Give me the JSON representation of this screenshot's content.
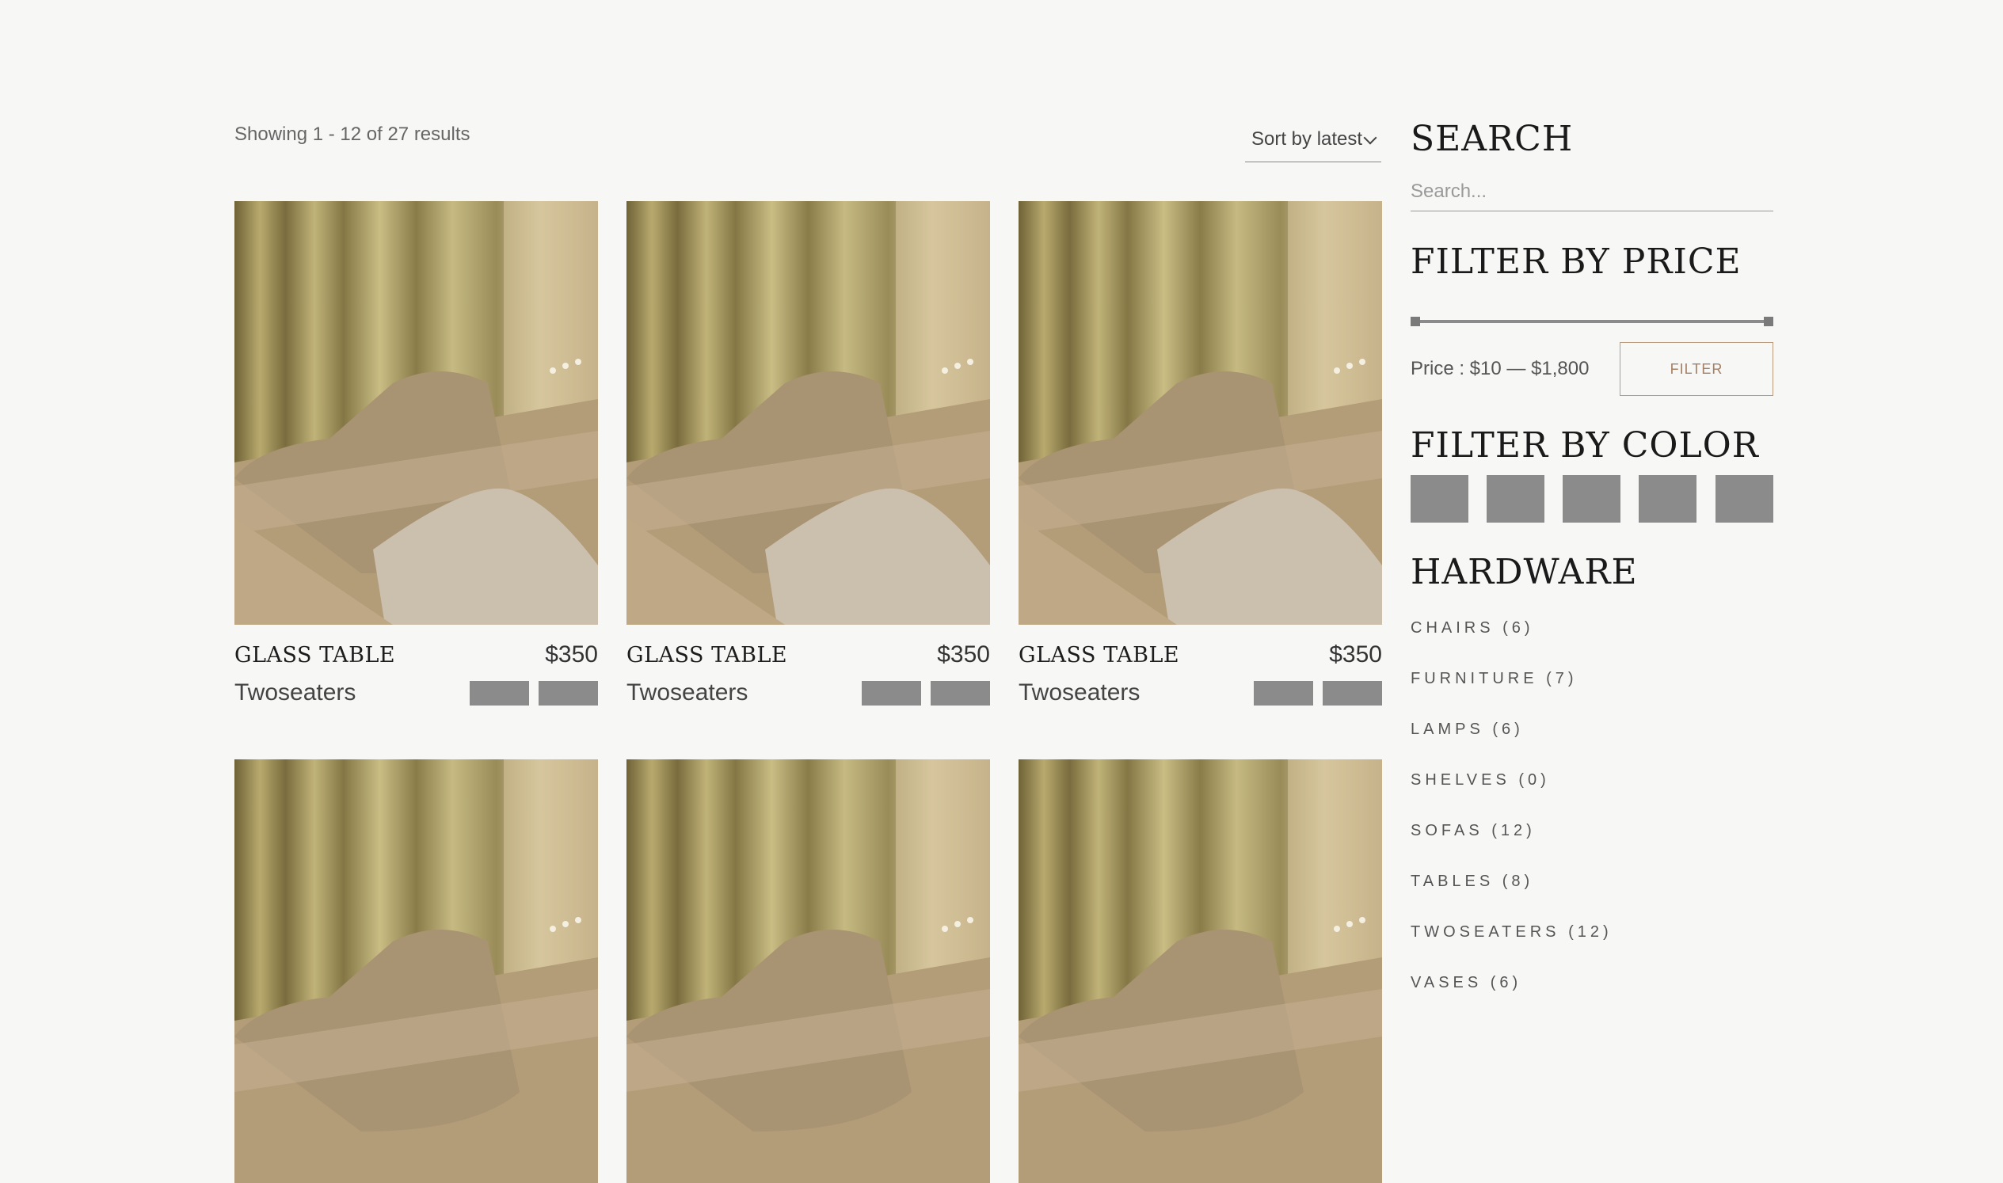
{
  "toolbar": {
    "results_text": "Showing 1 - 12 of 27 results",
    "sort_label": "Sort by latest"
  },
  "products": [
    {
      "title": "GLASS TABLE",
      "price": "$350",
      "category": "Twoseaters"
    },
    {
      "title": "GLASS TABLE",
      "price": "$350",
      "category": "Twoseaters"
    },
    {
      "title": "GLASS TABLE",
      "price": "$350",
      "category": "Twoseaters"
    },
    {
      "title": "",
      "price": "",
      "category": ""
    },
    {
      "title": "",
      "price": "",
      "category": ""
    },
    {
      "title": "",
      "price": "",
      "category": ""
    }
  ],
  "sidebar": {
    "search": {
      "heading": "SEARCH",
      "placeholder": "Search..."
    },
    "price": {
      "heading": "FILTER BY PRICE",
      "range_text": "Price : $10 — $1,800",
      "button_label": "FILTER",
      "min_fraction": 0,
      "max_fraction": 1
    },
    "color": {
      "heading": "FILTER BY COLOR",
      "swatches": [
        "#8b8b8b",
        "#8b8b8b",
        "#8b8b8b",
        "#8b8b8b",
        "#8b8b8b"
      ]
    },
    "hardware": {
      "heading": "HARDWARE",
      "categories": [
        "CHAIRS (6)",
        "FURNITURE (7)",
        "LAMPS (6)",
        "SHELVES (0)",
        "SOFAS (12)",
        "TABLES (8)",
        "TWOSEATERS (12)",
        "VASES (6)"
      ]
    }
  },
  "colors": {
    "accent": "#a57f63",
    "swatch": "#8b8b8b",
    "background": "#f7f7f5"
  }
}
